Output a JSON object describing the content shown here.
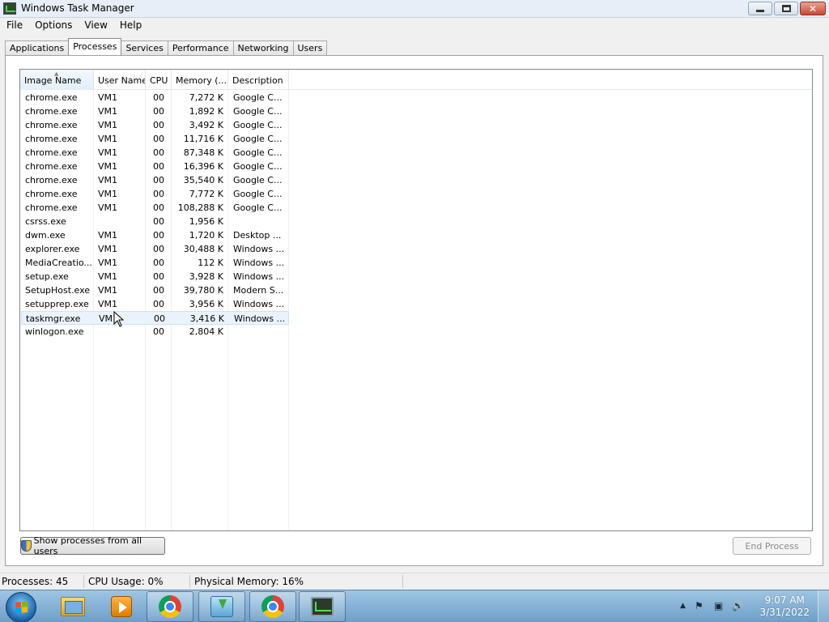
{
  "window": {
    "title": "Windows Task Manager",
    "icon": "task-manager-icon"
  },
  "menu": [
    "File",
    "Options",
    "View",
    "Help"
  ],
  "tabs": [
    "Applications",
    "Processes",
    "Services",
    "Performance",
    "Networking",
    "Users"
  ],
  "active_tab": "Processes",
  "columns": [
    "Image Name",
    "User Name",
    "CPU",
    "Memory (...",
    "Description"
  ],
  "sorted_column": "Image Name",
  "processes": [
    {
      "name": "chrome.exe",
      "user": "VM1",
      "cpu": "00",
      "memory": "7,272 K",
      "description": "Google C..."
    },
    {
      "name": "chrome.exe",
      "user": "VM1",
      "cpu": "00",
      "memory": "1,892 K",
      "description": "Google C..."
    },
    {
      "name": "chrome.exe",
      "user": "VM1",
      "cpu": "00",
      "memory": "3,492 K",
      "description": "Google C..."
    },
    {
      "name": "chrome.exe",
      "user": "VM1",
      "cpu": "00",
      "memory": "11,716 K",
      "description": "Google C..."
    },
    {
      "name": "chrome.exe",
      "user": "VM1",
      "cpu": "00",
      "memory": "87,348 K",
      "description": "Google C..."
    },
    {
      "name": "chrome.exe",
      "user": "VM1",
      "cpu": "00",
      "memory": "16,396 K",
      "description": "Google C..."
    },
    {
      "name": "chrome.exe",
      "user": "VM1",
      "cpu": "00",
      "memory": "35,540 K",
      "description": "Google C..."
    },
    {
      "name": "chrome.exe",
      "user": "VM1",
      "cpu": "00",
      "memory": "7,772 K",
      "description": "Google C..."
    },
    {
      "name": "chrome.exe",
      "user": "VM1",
      "cpu": "00",
      "memory": "108,288 K",
      "description": "Google C..."
    },
    {
      "name": "csrss.exe",
      "user": "",
      "cpu": "00",
      "memory": "1,956 K",
      "description": ""
    },
    {
      "name": "dwm.exe",
      "user": "VM1",
      "cpu": "00",
      "memory": "1,720 K",
      "description": "Desktop ..."
    },
    {
      "name": "explorer.exe",
      "user": "VM1",
      "cpu": "00",
      "memory": "30,488 K",
      "description": "Windows ..."
    },
    {
      "name": "MediaCreatio...",
      "user": "VM1",
      "cpu": "00",
      "memory": "112 K",
      "description": "Windows ..."
    },
    {
      "name": "setup.exe",
      "user": "VM1",
      "cpu": "00",
      "memory": "3,928 K",
      "description": "Windows ..."
    },
    {
      "name": "SetupHost.exe",
      "user": "VM1",
      "cpu": "00",
      "memory": "39,780 K",
      "description": "Modern S..."
    },
    {
      "name": "setupprep.exe",
      "user": "VM1",
      "cpu": "00",
      "memory": "3,956 K",
      "description": "Windows ..."
    },
    {
      "name": "taskmgr.exe",
      "user": "VM1",
      "cpu": "00",
      "memory": "3,416 K",
      "description": "Windows ..."
    },
    {
      "name": "winlogon.exe",
      "user": "",
      "cpu": "00",
      "memory": "2,804 K",
      "description": ""
    }
  ],
  "selected_process": "taskmgr.exe",
  "buttons": {
    "show_all": "Show processes from all users",
    "end_process": "End Process"
  },
  "status": {
    "processes": "Processes: 45",
    "cpu": "CPU Usage: 0%",
    "memory": "Physical Memory: 16%"
  },
  "taskbar": {
    "items": [
      "folder-icon",
      "media-player-icon",
      "chrome-icon",
      "setup-icon",
      "chrome-icon",
      "task-manager-icon"
    ],
    "clock_time": "9:07 AM",
    "clock_date": "3/31/2022"
  }
}
